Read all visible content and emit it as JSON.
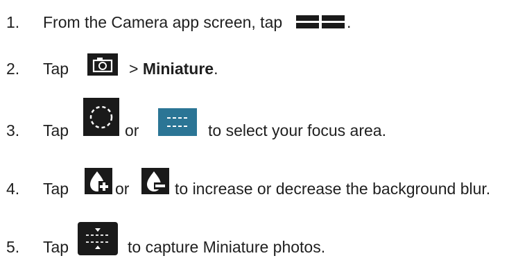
{
  "steps": [
    {
      "number": "1.",
      "before": "From the Camera app screen, tap",
      "after": ".",
      "icons": [
        "grid-layout-icon"
      ]
    },
    {
      "number": "2.",
      "before": "Tap",
      "after": "> ",
      "bold": "Miniature",
      "after2": ".",
      "icons": [
        "camera-settings-icon"
      ]
    },
    {
      "number": "3.",
      "before": "Tap",
      "middle": "or",
      "after": "to select your focus area.",
      "icons": [
        "circular-focus-icon",
        "linear-focus-icon"
      ]
    },
    {
      "number": "4.",
      "before": "Tap",
      "middle": "or",
      "after": "to increase or decrease the background blur.",
      "icons": [
        "blur-increase-icon",
        "blur-decrease-icon"
      ]
    },
    {
      "number": "5.",
      "before": "Tap",
      "after": "to capture Miniature photos.",
      "icons": [
        "miniature-shutter-icon"
      ]
    }
  ],
  "colors": {
    "text": "#1f1f1f",
    "icon_dark": "#1a1a1a",
    "icon_blue": "#2b7595"
  }
}
